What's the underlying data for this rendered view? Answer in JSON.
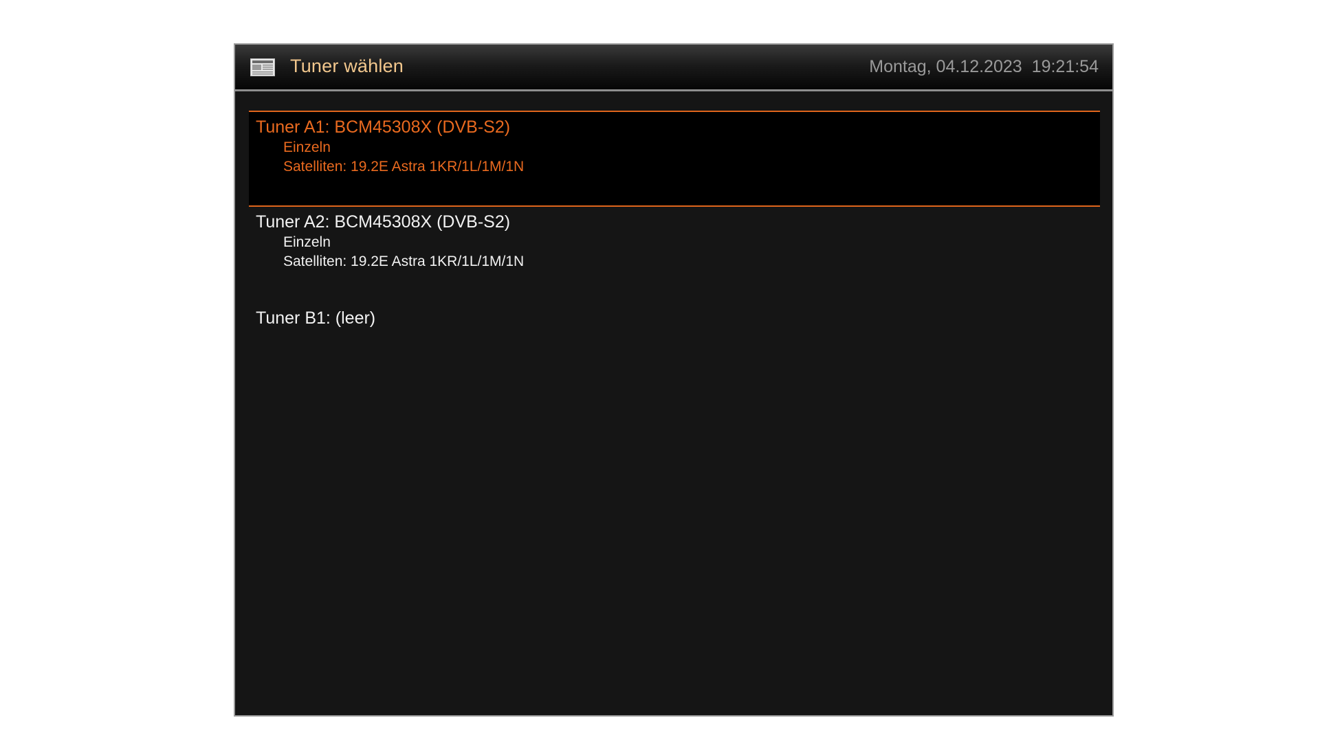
{
  "header": {
    "title": "Tuner wählen",
    "icon": "newspaper-icon",
    "date": "Montag, 04.12.2023",
    "time": "19:21:54"
  },
  "colors": {
    "accent": "#ea6a1f",
    "title": "#f2c78d",
    "datetime": "#9a9a9a",
    "background": "#151515",
    "selected_background": "#000000"
  },
  "tuners": [
    {
      "title": "Tuner A1: BCM45308X (DVB-S2)",
      "mode": "Einzeln",
      "satellites": "Satelliten: 19.2E Astra 1KR/1L/1M/1N",
      "selected": true
    },
    {
      "title": "Tuner A2: BCM45308X (DVB-S2)",
      "mode": "Einzeln",
      "satellites": "Satelliten: 19.2E Astra 1KR/1L/1M/1N",
      "selected": false
    },
    {
      "title": "Tuner B1: (leer)",
      "selected": false
    }
  ]
}
